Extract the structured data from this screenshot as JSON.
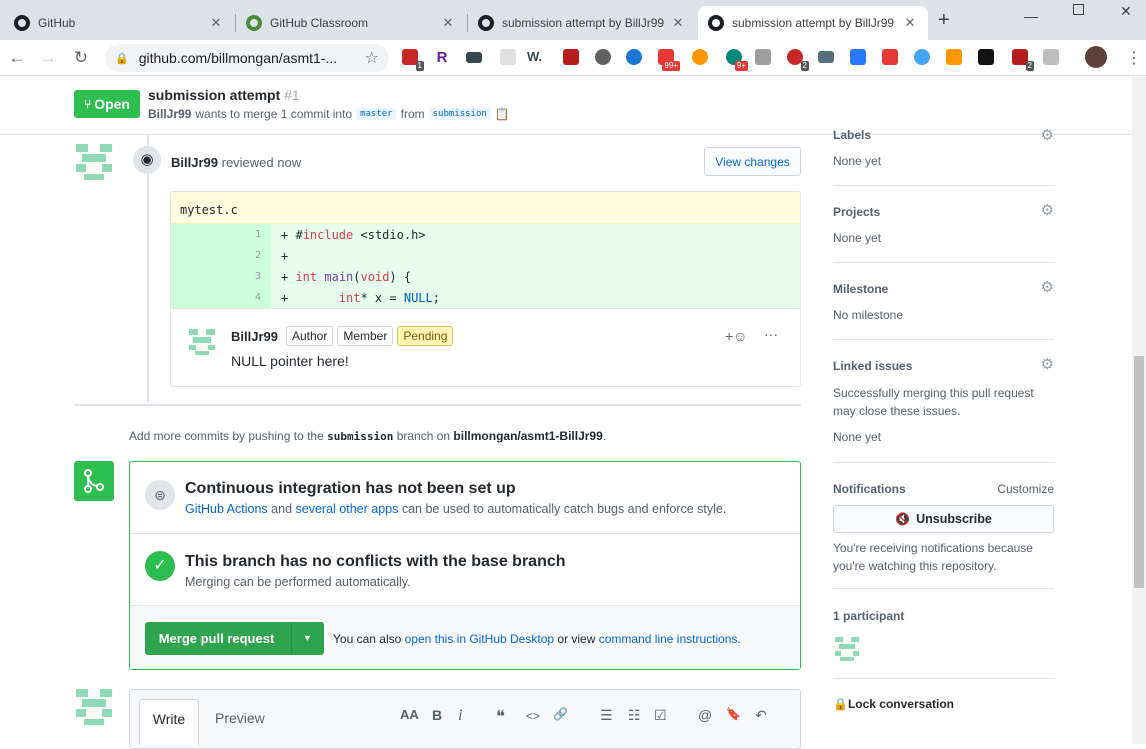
{
  "browser": {
    "tabs": [
      {
        "title": "GitHub",
        "icon": "github-icon"
      },
      {
        "title": "GitHub Classroom",
        "icon": "github-classroom-icon"
      },
      {
        "title": "submission attempt by BillJr99",
        "icon": "github-icon"
      },
      {
        "title": "submission attempt by BillJr99",
        "icon": "github-icon",
        "active": true
      }
    ],
    "new_tab": "+",
    "url": "github.com/billmongan/asmt1-...",
    "ext_badges": [
      "1",
      "99+",
      "9+",
      "2",
      "2"
    ],
    "ext_letters": {
      "r": "R",
      "w": "W."
    }
  },
  "pr": {
    "status": "Open",
    "title": "submission attempt",
    "number": "#1",
    "author": "BillJr99",
    "merge_text": "wants to merge 1 commit into",
    "base_branch": "master",
    "from_text": "from",
    "head_branch": "submission"
  },
  "review": {
    "reviewer": "BillJr99",
    "action": "reviewed now",
    "view_changes": "View changes",
    "file": "mytest.c",
    "lines": [
      {
        "n": "1",
        "code": "+ #include <stdio.h>"
      },
      {
        "n": "2",
        "code": "+"
      },
      {
        "n": "3",
        "code": "+ int main(void) {"
      },
      {
        "n": "4",
        "code": "+       int* x = NULL;"
      }
    ],
    "comment": {
      "author": "BillJr99",
      "labels": [
        "Author",
        "Member",
        "Pending"
      ],
      "body": "NULL pointer here!",
      "reaction": "+☺",
      "more": "···"
    }
  },
  "push_hint": {
    "prefix": "Add more commits by pushing to the",
    "branch": "submission",
    "mid": "branch on",
    "repo": "billmongan/asmt1-BillJr99",
    "suffix": "."
  },
  "checks": {
    "ci_title": "Continuous integration has not been set up",
    "ci_link1": "GitHub Actions",
    "ci_and": "and",
    "ci_link2": "several other apps",
    "ci_rest": "can be used to automatically catch bugs and enforce style.",
    "conflict_title": "This branch has no conflicts with the base branch",
    "conflict_sub": "Merging can be performed automatically.",
    "merge_button": "Merge pull request",
    "alt_prefix": "You can also",
    "alt_link1": "open this in GitHub Desktop",
    "alt_mid": "or view",
    "alt_link2": "command line instructions",
    "alt_suffix": "."
  },
  "editor": {
    "write_tab": "Write",
    "preview_tab": "Preview",
    "tools": [
      "AA",
      "B",
      "i",
      "❝",
      "<>",
      "🔗",
      "☰",
      "☷",
      "☑",
      "@",
      "🔖",
      "↶"
    ]
  },
  "sidebar": {
    "labels": {
      "heading": "Labels",
      "value": "None yet"
    },
    "projects": {
      "heading": "Projects",
      "value": "None yet"
    },
    "milestone": {
      "heading": "Milestone",
      "value": "No milestone"
    },
    "linked": {
      "heading": "Linked issues",
      "desc": "Successfully merging this pull request may close these issues.",
      "value": "None yet"
    },
    "notifications": {
      "heading": "Notifications",
      "customize": "Customize",
      "button": "Unsubscribe",
      "desc": "You're receiving notifications because you're watching this repository."
    },
    "participants": {
      "heading": "1 participant"
    },
    "lock": "Lock conversation"
  },
  "colors": {
    "green": "#2cbe4e",
    "merge_green": "#2ea44f",
    "link": "#0366d6",
    "avatar": "#8fd9b8"
  }
}
